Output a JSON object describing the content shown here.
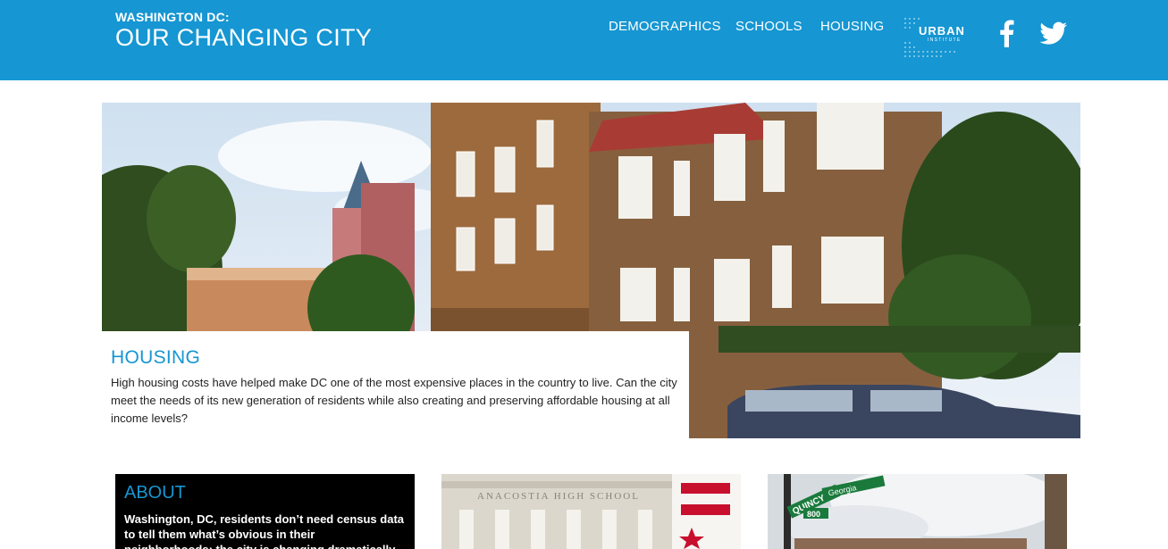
{
  "header": {
    "subtitle": "WASHINGTON DC:",
    "title": "OUR CHANGING CITY",
    "nav": [
      {
        "label": "DEMOGRAPHICS"
      },
      {
        "label": "SCHOOLS"
      },
      {
        "label": "HOUSING"
      }
    ],
    "logo_text": "URBAN",
    "logo_subtext": "INSTITUTE",
    "social_icons": [
      "facebook-icon",
      "twitter-icon"
    ],
    "background_color": "#1696d2"
  },
  "hero": {
    "heading": "HOUSING",
    "body": "High housing costs have helped make DC one of the most expensive places in the country to live. Can the city meet the needs of its new generation of residents while also creating and preserving affordable housing at all income levels?"
  },
  "cards": {
    "about": {
      "heading": "ABOUT",
      "body": "Washington, DC, residents don’t need census data to tell them what’s obvious in their neighborhoods: the city is changing dramatically. But numbers can"
    },
    "schools_image_text": "ANACOSTIA HIGH SCHOOL",
    "street_signs": [
      "QUINCY",
      "Georgia",
      "800"
    ]
  },
  "colors": {
    "accent": "#1696d2",
    "text": "#222222"
  }
}
